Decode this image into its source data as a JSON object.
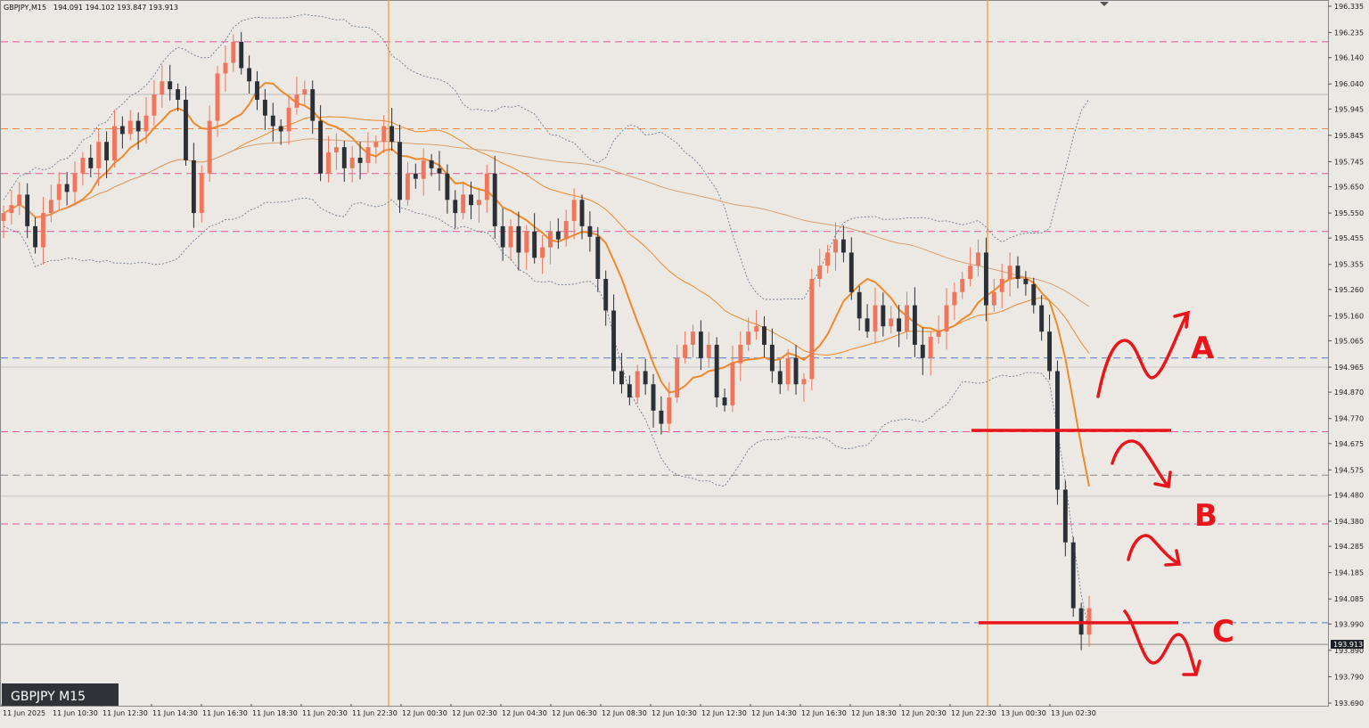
{
  "header": {
    "symbol_info": "GBPJPY,M15",
    "ohlc": "194.091 194.102 193.847 193.913"
  },
  "badge": {
    "label": "GBPJPY M15"
  },
  "chart_data": {
    "type": "candlestick",
    "symbol": "GBPJPY",
    "timeframe": "M15",
    "last_price": 193.913,
    "last_price_label": "193.913",
    "ylim": [
      193.69,
      196.335
    ],
    "y_ticks": [
      "196.335",
      "196.235",
      "196.140",
      "196.040",
      "195.945",
      "195.845",
      "195.745",
      "195.650",
      "195.550",
      "195.455",
      "195.355",
      "195.260",
      "195.160",
      "195.065",
      "194.965",
      "194.870",
      "194.770",
      "194.675",
      "194.575",
      "194.480",
      "194.380",
      "194.285",
      "194.185",
      "194.085",
      "193.990",
      "193.890",
      "193.790",
      "193.690"
    ],
    "x_ticks": [
      "11 Jun 2025",
      "11 Jun 10:30",
      "11 Jun 12:30",
      "11 Jun 14:30",
      "11 Jun 16:30",
      "11 Jun 18:30",
      "11 Jun 20:30",
      "11 Jun 22:30",
      "12 Jun 00:30",
      "12 Jun 02:30",
      "12 Jun 04:30",
      "12 Jun 06:30",
      "12 Jun 08:30",
      "12 Jun 10:30",
      "12 Jun 12:30",
      "12 Jun 14:30",
      "12 Jun 16:30",
      "12 Jun 18:30",
      "12 Jun 20:30",
      "12 Jun 22:30",
      "13 Jun 00:30",
      "13 Jun 02:30"
    ],
    "session_lines": [
      "11 Jun 22:45",
      "12 Jun 22:45"
    ],
    "horizontal_levels": [
      {
        "price": 196.2,
        "style": "dash",
        "color": "#e8559a"
      },
      {
        "price": 195.87,
        "style": "dash",
        "color": "#f08a48"
      },
      {
        "price": 195.7,
        "style": "dash",
        "color": "#e8559a"
      },
      {
        "price": 195.48,
        "style": "dash",
        "color": "#e8559a"
      },
      {
        "price": 195.0,
        "style": "dash",
        "color": "#4e7fc9"
      },
      {
        "price": 194.72,
        "style": "dash",
        "color": "#e8559a"
      },
      {
        "price": 194.555,
        "style": "dash",
        "color": "#8a8a8a"
      },
      {
        "price": 194.37,
        "style": "dash",
        "color": "#e8559a"
      },
      {
        "price": 193.995,
        "style": "dash",
        "color": "#4e7fc9"
      },
      {
        "price": 196.0,
        "style": "solid",
        "color": "#b9b9b9"
      },
      {
        "price": 194.965,
        "style": "solid",
        "color": "#c8c8c8"
      },
      {
        "price": 194.475,
        "style": "solid",
        "color": "#c8c8c8"
      },
      {
        "price": 193.913,
        "style": "solid",
        "color": "#8a8a8a"
      }
    ],
    "key_levels": [
      {
        "price": 194.725,
        "color": "#e8161b"
      },
      {
        "price": 193.995,
        "color": "#e8161b"
      }
    ],
    "scenarios": [
      "A",
      "B",
      "C"
    ],
    "colors": {
      "background": "#ece9e5",
      "bull_candle": "#f0755a",
      "bear_candle": "#2b2f36",
      "ma_fast": "#f0892a",
      "ma_slow": "#d9a070",
      "bollinger": "#6f7a8c",
      "annotation": "#e8161b"
    },
    "closes": [
      195.55,
      195.58,
      195.62,
      195.5,
      195.42,
      195.55,
      195.6,
      195.66,
      195.63,
      195.7,
      195.76,
      195.72,
      195.82,
      195.75,
      195.88,
      195.85,
      195.9,
      195.86,
      195.92,
      196.0,
      196.05,
      196.02,
      195.98,
      195.75,
      195.55,
      195.7,
      195.9,
      196.08,
      196.12,
      196.2,
      196.1,
      196.05,
      195.98,
      195.92,
      195.88,
      195.86,
      195.95,
      196.0,
      196.02,
      195.9,
      195.7,
      195.78,
      195.8,
      195.72,
      195.76,
      195.74,
      195.8,
      195.82,
      195.88,
      195.82,
      195.6,
      195.7,
      195.68,
      195.75,
      195.72,
      195.7,
      195.6,
      195.55,
      195.62,
      195.58,
      195.6,
      195.7,
      195.5,
      195.42,
      195.5,
      195.4,
      195.48,
      195.38,
      195.42,
      195.48,
      195.45,
      195.52,
      195.6,
      195.5,
      195.46,
      195.3,
      195.18,
      194.95,
      194.9,
      194.85,
      194.95,
      194.9,
      194.8,
      194.75,
      194.85,
      195.0,
      195.05,
      195.1,
      195.0,
      195.05,
      194.85,
      194.82,
      194.98,
      195.05,
      195.1,
      195.12,
      195.05,
      194.95,
      194.9,
      195.0,
      194.9,
      194.92,
      195.3,
      195.35,
      195.4,
      195.45,
      195.4,
      195.25,
      195.15,
      195.1,
      195.2,
      195.12,
      195.15,
      195.1,
      195.2,
      195.05,
      195.0,
      195.08,
      195.1,
      195.2,
      195.25,
      195.3,
      195.35,
      195.4,
      195.2,
      195.25,
      195.3,
      195.35,
      195.3,
      195.28,
      195.2,
      195.1,
      194.95,
      194.5,
      194.3,
      194.05,
      193.95,
      194.05
    ]
  }
}
